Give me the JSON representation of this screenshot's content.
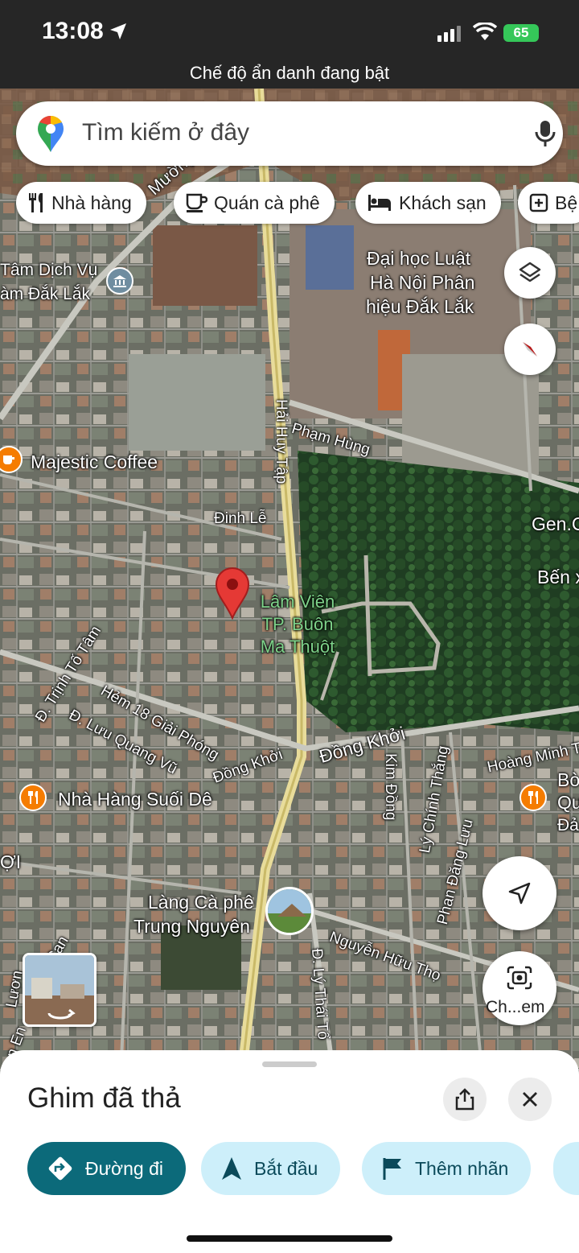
{
  "status_bar": {
    "time": "13:08",
    "battery": "65",
    "incognito_text": "Chế độ ẩn danh đang bật"
  },
  "search": {
    "placeholder": "Tìm kiếm ở đây",
    "left_icon": "google-maps-pin-icon",
    "right_icon": "microphone-icon"
  },
  "chips": [
    {
      "label": "Nhà hàng",
      "icon": "fork-knife-icon"
    },
    {
      "label": "Quán cà phê",
      "icon": "coffee-cup-icon"
    },
    {
      "label": "Khách sạn",
      "icon": "bed-icon"
    },
    {
      "label": "Bệ",
      "icon": "plus-square-icon"
    }
  ],
  "map": {
    "labels": {
      "tam_dich_vu": "Tâm Dịch Vụ",
      "am_dak_lak": "àm Đắk Lắk",
      "dai_hoc_1": "Đại học Luật",
      "dai_hoc_2": "Hà Nội Phân",
      "dai_hoc_3": "hiệu Đắk Lắk",
      "majestic": "Majestic Coffee",
      "pham_hung": "Phạm Hùng",
      "hai_huy_tap": "Hải Huy Tập",
      "muong_thanh": "Mường Th",
      "dinh_le": "Đinh Lễ",
      "gen": "Gen.C",
      "ben": "Bến x",
      "lam_vien_1": "Lâm Viên",
      "lam_vien_2": "TP. Buôn",
      "lam_vien_3": "Ma Thuột",
      "trinh_to_tam": "Đ. Trịnh Tố Tâm",
      "hem18": "Hẻm 18 Giải Phóng",
      "luu_quang_vu": "Đ. Lưu Quang Vũ",
      "dong_khoi_1": "Đồng Khởi",
      "dong_khoi_2": "Đồng Khởi",
      "kim_dong": "Kim Đồng",
      "ly_chinh_thang": "Lý Chính Thắng",
      "phan_dang_luu": "Phan Đăng Lưu",
      "hoang_minh_thao": "Hoàng Minh Thảo",
      "bo": "Bò",
      "qu": "Qu",
      "da": "Đả",
      "nha_hang_suoi_de": "Nhà Hàng Suối Dê",
      "loi": "ỢI",
      "lang_ca_phe_1": "Làng Cà phê",
      "lang_ca_phe_2": "Trung Nguyên",
      "nguyen_huu_tho": "Nguyễn Hữu Thọ",
      "ly_thai_to": "Đ. Lý Thái Tổ",
      "can": "Can",
      "luong": "Lươn",
      "en": "n En"
    },
    "lens_label": "Ch...em"
  },
  "sheet": {
    "title": "Ghim đã thả",
    "actions": [
      {
        "label": "Đường đi",
        "icon": "directions-icon"
      },
      {
        "label": "Bắt đầu",
        "icon": "navigation-arrow-icon"
      },
      {
        "label": "Thêm nhãn",
        "icon": "flag-icon"
      }
    ]
  },
  "colors": {
    "red_pin": "#e53935",
    "primary_button": "#0c6a7a",
    "secondary_button": "#cdeffa",
    "poi_orange": "#f57c00"
  }
}
